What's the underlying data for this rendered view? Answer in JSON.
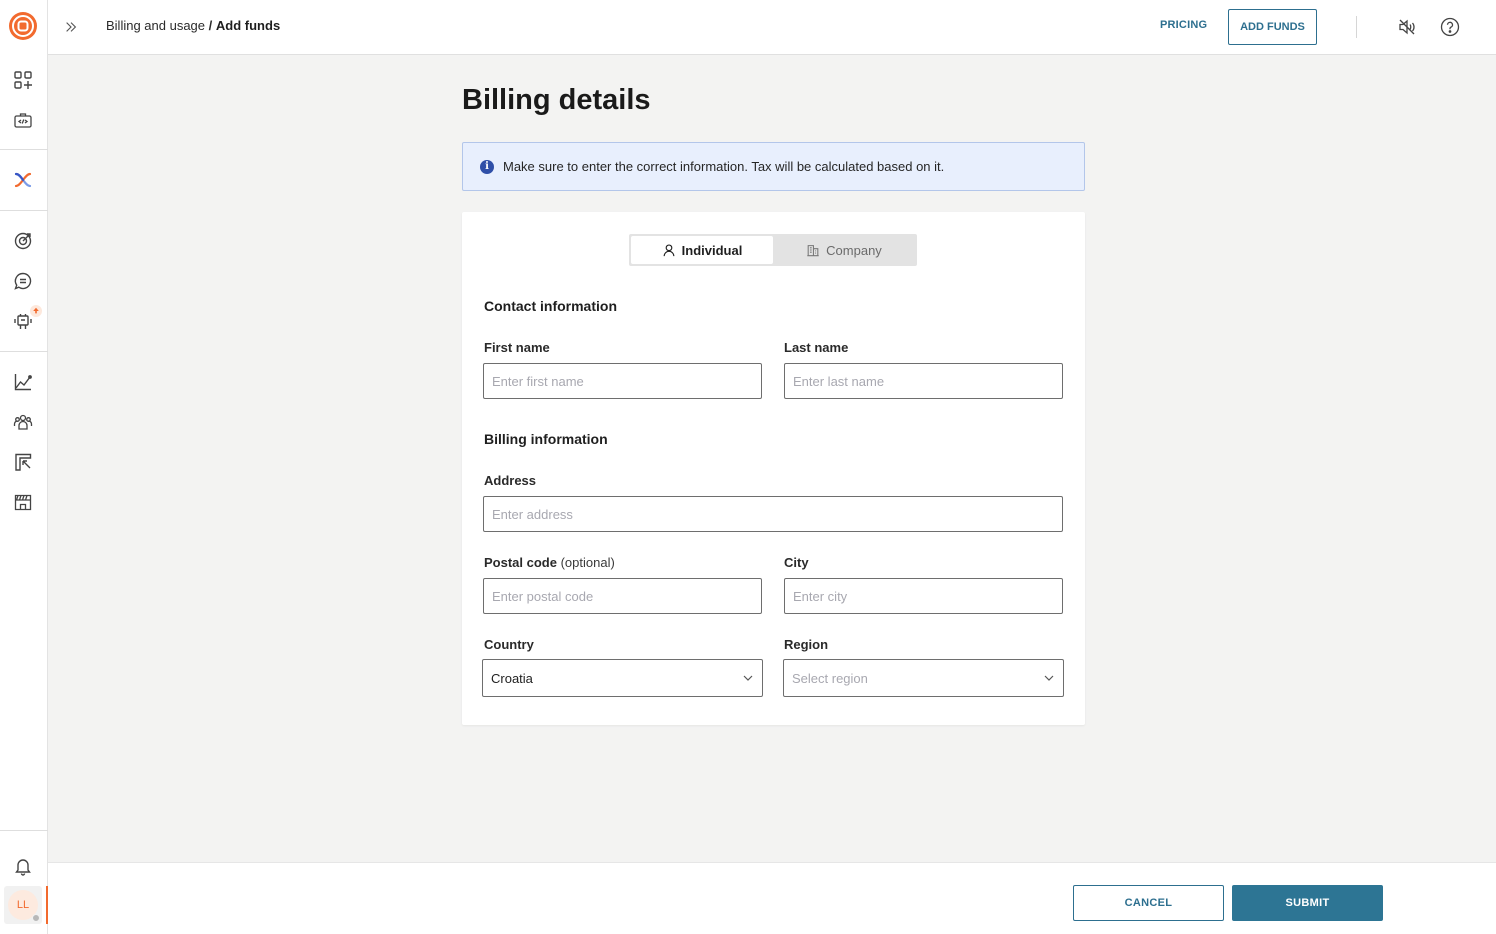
{
  "brand": {
    "accent": "#f26a2e",
    "primary": "#2d7594"
  },
  "sidebar": {
    "items": [
      {
        "name": "dashboard-add",
        "icon": "apps-add-icon"
      },
      {
        "name": "developer-tools",
        "icon": "code-briefcase-icon"
      },
      {
        "name": "integrations",
        "icon": "crossover-logo-icon"
      },
      {
        "name": "goals",
        "icon": "target-icon"
      },
      {
        "name": "conversations",
        "icon": "chat-icon"
      },
      {
        "name": "bots",
        "icon": "robot-icon",
        "badge": "upgrade-arrow"
      },
      {
        "name": "analytics",
        "icon": "line-chart-icon"
      },
      {
        "name": "audience",
        "icon": "people-icon"
      },
      {
        "name": "exports",
        "icon": "export-icon"
      },
      {
        "name": "marketplace",
        "icon": "store-icon"
      }
    ],
    "notifications_icon": "bell-icon",
    "avatar_initials": "LL"
  },
  "topbar": {
    "breadcrumb": {
      "parent": "Billing and usage",
      "separator": "/",
      "current": "Add funds"
    },
    "pricing_label": "PRICING",
    "add_funds_label": "ADD FUNDS"
  },
  "page": {
    "title": "Billing details",
    "info_banner": "Make sure to enter the correct information. Tax will be calculated based on it."
  },
  "form": {
    "tabs": [
      {
        "label": "Individual",
        "active": true
      },
      {
        "label": "Company",
        "active": false
      }
    ],
    "contact_title": "Contact information",
    "first_name": {
      "label": "First name",
      "placeholder": "Enter first name",
      "value": ""
    },
    "last_name": {
      "label": "Last name",
      "placeholder": "Enter last name",
      "value": ""
    },
    "billing_title": "Billing information",
    "address": {
      "label": "Address",
      "placeholder": "Enter address",
      "value": ""
    },
    "postal_code": {
      "label": "Postal code",
      "optional": "(optional)",
      "placeholder": "Enter postal code",
      "value": ""
    },
    "city": {
      "label": "City",
      "placeholder": "Enter city",
      "value": ""
    },
    "country": {
      "label": "Country",
      "value": "Croatia"
    },
    "region": {
      "label": "Region",
      "placeholder": "Select region"
    }
  },
  "footer": {
    "cancel_label": "CANCEL",
    "submit_label": "SUBMIT"
  }
}
